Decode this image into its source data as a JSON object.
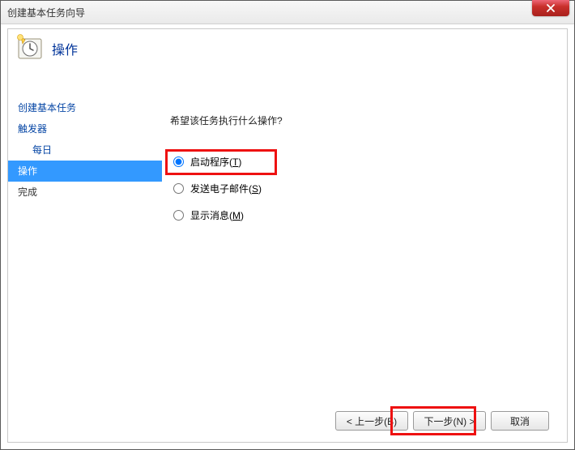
{
  "window": {
    "title": "创建基本任务向导"
  },
  "header": {
    "title": "操作",
    "icon": "wizard-clock-icon"
  },
  "steps": [
    {
      "id": "create",
      "label": "创建基本任务",
      "kind": "link"
    },
    {
      "id": "trigger",
      "label": "触发器",
      "kind": "link"
    },
    {
      "id": "trigger-daily",
      "label": "每日",
      "kind": "sub"
    },
    {
      "id": "action",
      "label": "操作",
      "kind": "selected"
    },
    {
      "id": "finish",
      "label": "完成",
      "kind": "done"
    }
  ],
  "panel": {
    "question": "希望该任务执行什么操作?",
    "options": [
      {
        "id": "start-program",
        "label_pre": "启动程序(",
        "hotkey": "T",
        "label_post": ")",
        "checked": true,
        "highlight": true
      },
      {
        "id": "send-email",
        "label_pre": "发送电子邮件(",
        "hotkey": "S",
        "label_post": ")",
        "checked": false,
        "highlight": false
      },
      {
        "id": "show-message",
        "label_pre": "显示消息(",
        "hotkey": "M",
        "label_post": ")",
        "checked": false,
        "highlight": false
      }
    ]
  },
  "footer": {
    "back_pre": "< 上一步(",
    "back_hot": "B",
    "back_post": ")",
    "next_pre": "下一步(",
    "next_hot": "N",
    "next_post": ") >",
    "cancel": "取消",
    "highlight_next": true
  }
}
